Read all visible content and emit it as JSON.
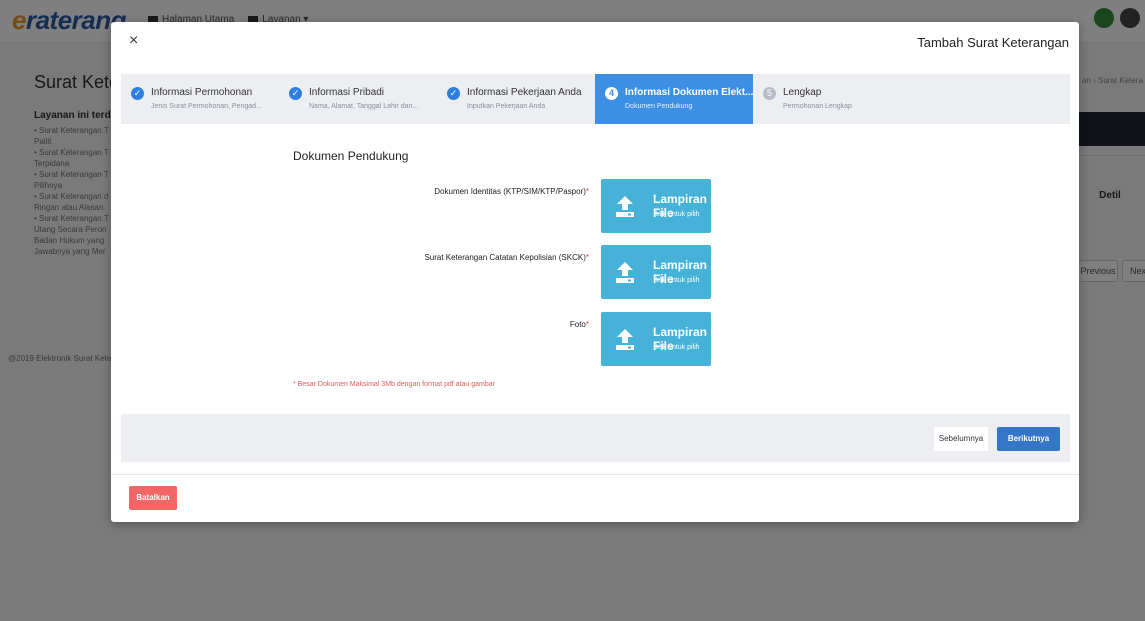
{
  "background": {
    "brand": {
      "prefix": "e",
      "rest": "raterang"
    },
    "topnav": [
      "Halaman Utama",
      "Layanan ▾"
    ],
    "page_title": "Surat Ketera",
    "subtitle": "Layanan ini terdiri da",
    "list": [
      "• Surat Keterangan T",
      "Pailit",
      "• Surat Keterangan T",
      "Terpidana",
      "• Surat Keterangan T",
      "Pilihnya",
      "• Surat Keterangan d",
      "Ringan atau Alasan",
      "• Surat Keterangan T",
      "Utang Secara Peron",
      "Badan Hukum yang",
      "Jawabnya yang Mer"
    ],
    "footer": "@2019 Elektronik Surat Keter",
    "breadcrumb": "an › Surat Ketera",
    "detail_header": "Detil",
    "previous": "Previous",
    "next": "Nex"
  },
  "modal": {
    "close": "×",
    "title": "Tambah Surat Keterangan",
    "steps": [
      {
        "label": "Informasi Permohonan",
        "sub": "Jenis Surat Permohonan, Pengad...",
        "icon": "✓",
        "state": "done"
      },
      {
        "label": "Informasi Pribadi",
        "sub": "Nama, Alamat, Tanggal Lahir dan...",
        "icon": "✓",
        "state": "done"
      },
      {
        "label": "Informasi Pekerjaan Anda",
        "sub": "Inputkan Pekerjaan Anda",
        "icon": "✓",
        "state": "done"
      },
      {
        "label": "Informasi Dokumen Elekt...",
        "sub": "Dokumen Pendukung",
        "icon": "4",
        "state": "active"
      },
      {
        "label": "Lengkap",
        "sub": "Permohonan Lengkap",
        "icon": "5",
        "state": "pending"
      }
    ],
    "section_title": "Dokumen Pendukung",
    "documents": [
      {
        "label": "Dokumen Identitas (KTP/SIM/KTP/Paspor)",
        "required": "*",
        "button_title": "Lampiran File",
        "button_sub": "klik untuk pilih"
      },
      {
        "label": "Surat Keterangan Catatan Kepolisian (SKCK)",
        "required": "*",
        "button_title": "Lampiran File",
        "button_sub": "klik untuk pilih"
      },
      {
        "label": "Foto",
        "required": "*",
        "button_title": "Lampiran File",
        "button_sub": "klik untuk pilih"
      }
    ],
    "note": "* Besar Dokumen Maksimal 3Mb dengan format pdf atau gambar",
    "prev_label": "Sebelumnya",
    "next_label": "Berikutnya",
    "cancel_label": "Batalkan"
  },
  "colors": {
    "step_done": "#2f7fe0",
    "step_active": "#3d8fe3",
    "upload": "#46b2d8",
    "next": "#3576c8",
    "cancel": "#f26666",
    "required": "#e23a3a"
  }
}
